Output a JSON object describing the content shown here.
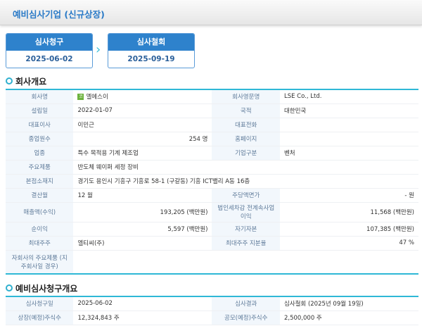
{
  "header": {
    "title": "예비심사기업 (신규상장)"
  },
  "steps": [
    {
      "label": "심사청구",
      "date": "2025-06-02"
    },
    {
      "label": "심사철회",
      "date": "2025-09-19"
    }
  ],
  "overview": {
    "title": "회사개요",
    "rows": [
      [
        "회사명",
        "엘에스이",
        "회사영문명",
        "LSE Co., Ltd."
      ],
      [
        "설립일",
        "2022-01-07",
        "국적",
        "대한민국"
      ],
      [
        "대표이사",
        "이민근",
        "대표전화",
        ""
      ],
      [
        "종업원수",
        "254 명",
        "홈페이지",
        ""
      ],
      [
        "업종",
        "특수 목적용 기계 제조업",
        "기업구분",
        "벤처"
      ],
      [
        "주요제품",
        "반도체 웨이퍼 세정 장비"
      ],
      [
        "본점소재지",
        "경기도 용인시 기흥구 기흥로 58-1 (구갈동) 기흥 ICT밸리 A동 16층"
      ],
      [
        "결산월",
        "12 월",
        "주당액면가",
        "- 원"
      ],
      [
        "매출액(수익)",
        "193,205 (백만원)",
        "법인세차감 전계속사업이익",
        "11,568 (백만원)"
      ],
      [
        "순이익",
        "5,597 (백만원)",
        "자기자본",
        "107,385 (백만원)"
      ],
      [
        "최대주주",
        "엘티씨(주)",
        "최대주주 지분율",
        "47 %"
      ],
      [
        "자회사의 주요제품 (지주회사일 경우)",
        ""
      ]
    ],
    "market_badge": "코"
  },
  "request": {
    "title": "예비심사청구개요",
    "rows": [
      [
        "심사청구일",
        "2025-06-02",
        "심사결과",
        "심사철회 (2025년 09월 19일)"
      ],
      [
        "상장(예정)주식수",
        "12,324,843 주",
        "공모(예정)주식수",
        "2,500,000 주"
      ]
    ]
  }
}
